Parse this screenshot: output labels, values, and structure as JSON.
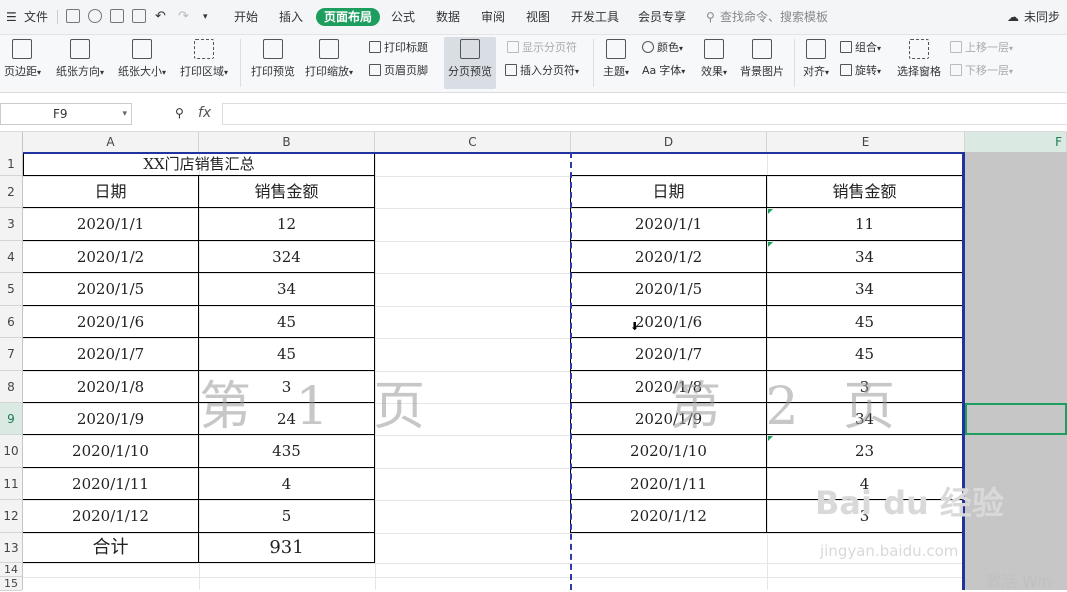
{
  "menubar": {
    "file": "文件",
    "tabs": [
      "开始",
      "插入",
      "页面布局",
      "公式",
      "数据",
      "审阅",
      "视图",
      "开发工具",
      "会员专享"
    ],
    "active_tab": "页面布局",
    "search": "查找命令、搜索模板",
    "sync": "未同步"
  },
  "ribbon": {
    "margins": "页边距",
    "orientation": "纸张方向",
    "size": "纸张大小",
    "print_area": "打印区域",
    "print_preview": "打印预览",
    "print_scale": "打印缩放",
    "print_titles": "打印标题",
    "header_footer": "页眉页脚",
    "page_break_preview": "分页预览",
    "show_page_breaks": "显示分页符",
    "insert_page_break": "插入分页符",
    "theme": "主题",
    "colors": "颜色",
    "fonts": "字体",
    "effects": "效果",
    "background": "背景图片",
    "align": "对齐",
    "group": "组合",
    "rotate": "旋转",
    "selection_pane": "选择窗格",
    "bring_forward": "上移一层",
    "send_backward": "下移一层",
    "font_icon_text": "Aa"
  },
  "formula_bar": {
    "cell_ref": "F9",
    "fx": "fx",
    "content": ""
  },
  "columns": [
    "A",
    "B",
    "C",
    "D",
    "E",
    "F"
  ],
  "rows": [
    "1",
    "2",
    "3",
    "4",
    "5",
    "6",
    "7",
    "8",
    "9",
    "10",
    "11",
    "12",
    "13",
    "14",
    "15"
  ],
  "table1": {
    "title": "XX门店销售汇总",
    "headers": [
      "日期",
      "销售金额"
    ],
    "rows": [
      [
        "2020/1/1",
        "12"
      ],
      [
        "2020/1/2",
        "324"
      ],
      [
        "2020/1/5",
        "34"
      ],
      [
        "2020/1/6",
        "45"
      ],
      [
        "2020/1/7",
        "45"
      ],
      [
        "2020/1/8",
        "3"
      ],
      [
        "2020/1/9",
        "24"
      ],
      [
        "2020/1/10",
        "435"
      ],
      [
        "2020/1/11",
        "4"
      ],
      [
        "2020/1/12",
        "5"
      ]
    ],
    "total_label": "合计",
    "total_value": "931"
  },
  "table2": {
    "headers": [
      "日期",
      "销售金额"
    ],
    "rows": [
      [
        "2020/1/1",
        "11"
      ],
      [
        "2020/1/2",
        "34"
      ],
      [
        "2020/1/5",
        "34"
      ],
      [
        "2020/1/6",
        "45"
      ],
      [
        "2020/1/7",
        "45"
      ],
      [
        "2020/1/8",
        "3"
      ],
      [
        "2020/1/9",
        "34"
      ],
      [
        "2020/1/10",
        "23"
      ],
      [
        "2020/1/11",
        "4"
      ],
      [
        "2020/1/12",
        "3"
      ]
    ]
  },
  "watermarks": {
    "page1": "第 1 页",
    "page2": "第 2 页"
  },
  "overlay": {
    "activate": "激活 Win",
    "logo": "Bai du 经验",
    "url": "jingyan.baidu.com"
  },
  "selected_row": "9",
  "colors": {
    "accent": "#1e9e5e",
    "page_border": "#2233a0"
  }
}
